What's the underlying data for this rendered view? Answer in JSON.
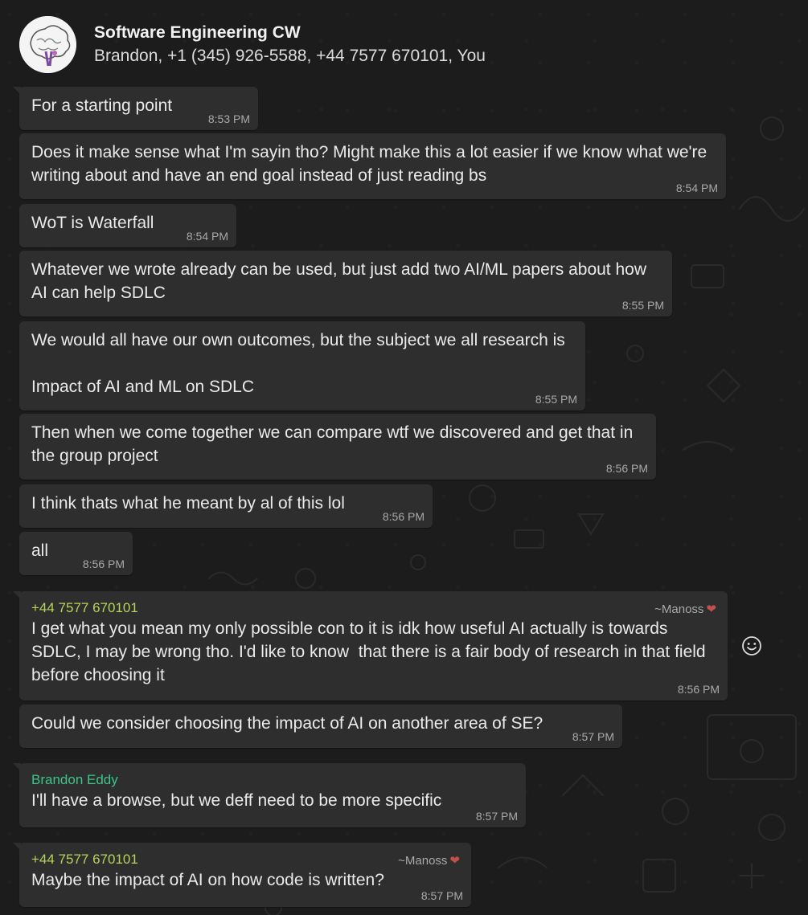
{
  "header": {
    "title": "Software Engineering CW",
    "members": "Brandon, +1 (345) 926-5588, +44 7577 670101, You"
  },
  "messages": [
    {
      "text": "For a starting point",
      "time": "8:53 PM"
    },
    {
      "text": "Does it make sense what I'm sayin tho? Might make this a lot easier if we know what we're\nwriting about and have an end goal instead of just reading bs",
      "time": "8:54 PM"
    },
    {
      "text": "WoT is Waterfall",
      "time": "8:54 PM"
    },
    {
      "text": "Whatever we wrote already can be used, but just add two AI/ML papers about how\nAI can help SDLC",
      "time": "8:55 PM"
    },
    {
      "text": "We would all have our own outcomes, but the subject we all research is\n\nImpact of AI and ML on SDLC",
      "time": "8:55 PM"
    },
    {
      "text": "Then when we come together we can compare wtf we discovered and get that in\nthe group project",
      "time": "8:56 PM"
    },
    {
      "text": "I think thats what he meant by al of this lol",
      "time": "8:56 PM"
    },
    {
      "text": "all",
      "time": "8:56 PM"
    },
    {
      "sender": "+44 7577 670101",
      "alias": "~Manoss",
      "text": "I get what you mean my only possible con to it is idk how useful AI actually is towards\nSDLC, I may be wrong tho. I'd like to know  that there is a fair body of research in that field\nbefore choosing it",
      "time": "8:56 PM"
    },
    {
      "text": "Could we consider choosing the impact of AI on another area of SE?",
      "time": "8:57 PM"
    },
    {
      "sender": "Brandon Eddy",
      "text": "I'll have a browse, but we deff need to be more specific",
      "time": "8:57 PM"
    },
    {
      "sender": "+44 7577 670101",
      "alias": "~Manoss",
      "text": "Maybe the impact of AI on how code is written?",
      "time": "8:57 PM"
    }
  ],
  "icons": {
    "heart": "heart-icon",
    "react": "smiley-icon"
  },
  "colors": {
    "bubble": "#2e2e2e",
    "background": "#1c1c1c",
    "sender_phone": "#b7d35a",
    "sender_brandon": "#3cc48a",
    "heart": "#c0504d"
  }
}
